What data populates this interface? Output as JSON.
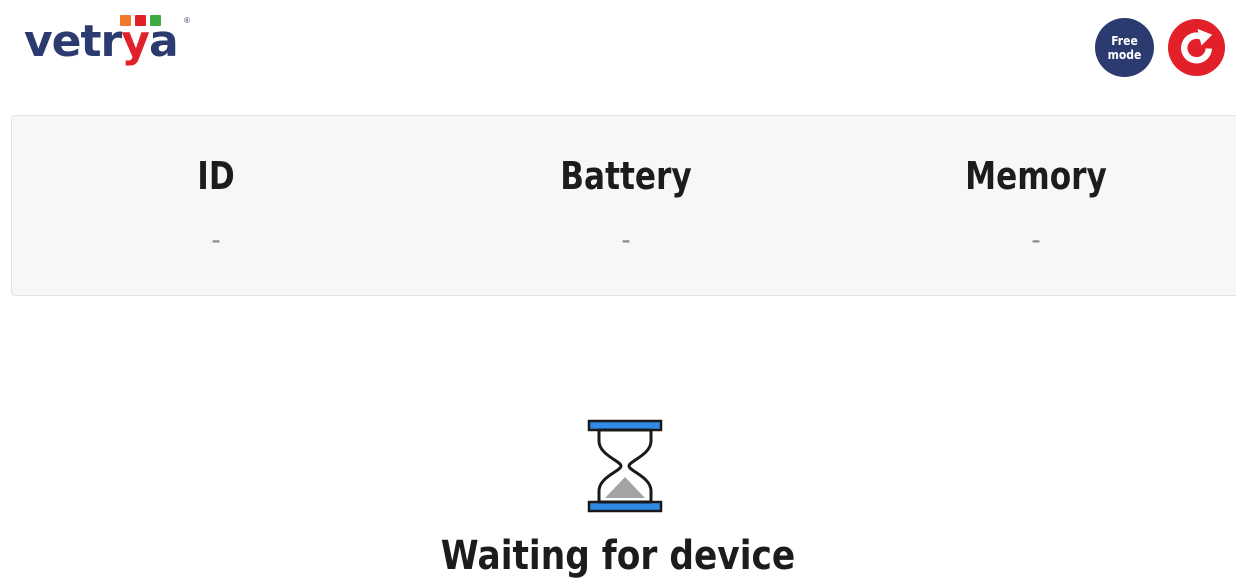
{
  "header": {
    "logo": {
      "text_prefix": "vetr",
      "text_y": "y",
      "text_suffix": "a",
      "registered_mark": "®",
      "square_colors": [
        "#f0792b",
        "#e2202a",
        "#3faa3f"
      ],
      "text_color": "#2c3b6f",
      "accent_color": "#e2202a"
    },
    "free_mode_button": {
      "label": "Free\nmode",
      "color": "#2c3b6f"
    },
    "refresh_button": {
      "icon": "refresh-icon",
      "color": "#e2202a"
    }
  },
  "info_panel": {
    "columns": [
      {
        "label": "ID",
        "value": "-"
      },
      {
        "label": "Battery",
        "value": "-"
      },
      {
        "label": "Memory",
        "value": "-"
      }
    ]
  },
  "status": {
    "icon": "hourglass-icon",
    "text": "Waiting for device",
    "icon_accent_color": "#2f8be6"
  }
}
